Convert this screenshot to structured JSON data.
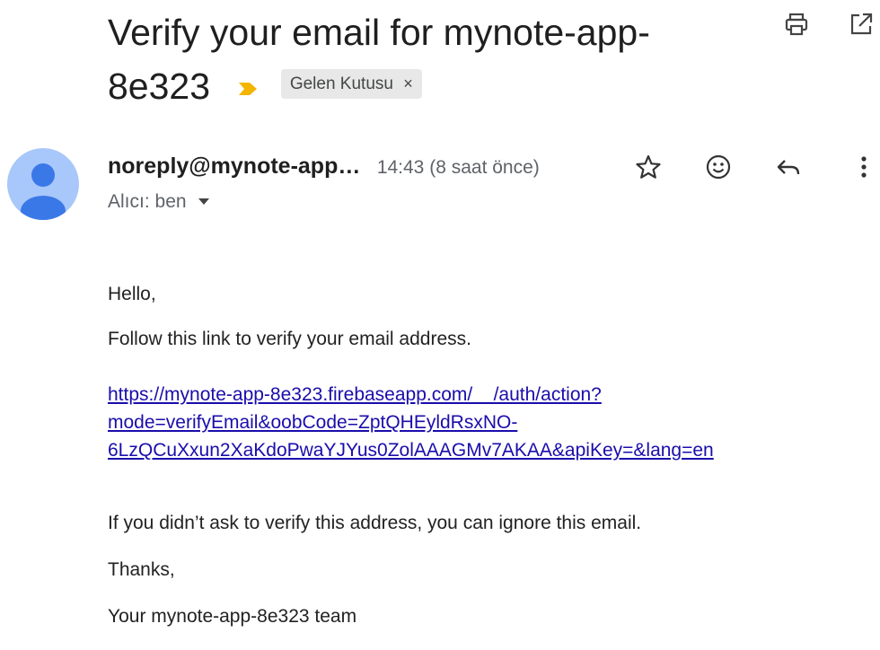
{
  "subject": {
    "line1": "Verify your email for mynote-app-",
    "line2": "8e323",
    "label": "Gelen Kutusu",
    "label_close": "×"
  },
  "toolbar": {
    "print_icon": "print-icon",
    "open_new_window_icon": "open-in-new-icon"
  },
  "sender": {
    "name": "noreply@mynote-app…",
    "time": "14:43 (8 saat önce)",
    "to_label": "Alıcı: ben"
  },
  "actions": [
    "star-icon",
    "emoji-icon",
    "reply-icon",
    "more-vert-icon"
  ],
  "body": {
    "greeting": "Hello,",
    "intro": "Follow this link to verify your email address.",
    "link_lines": [
      "https://mynote-app-8e323.firebaseapp.com/__/auth/action?",
      "mode=verifyEmail&oobCode=ZptQHEyldRsxNO-",
      "6LzQCuXxun2XaKdoPwaYJYus0ZolAAAGMv7AKAA&apiKey=&lang=en"
    ],
    "ignore": "If you didn’t ask to verify this address, you can ignore this email.",
    "thanks": "Thanks,",
    "signature": "Your mynote-app-8e323 team"
  },
  "colors": {
    "link": "#1a0dab",
    "label_arrow": "#f4b400",
    "avatar": "#a8c7fa",
    "avatar_figure": "#3b78e7"
  }
}
